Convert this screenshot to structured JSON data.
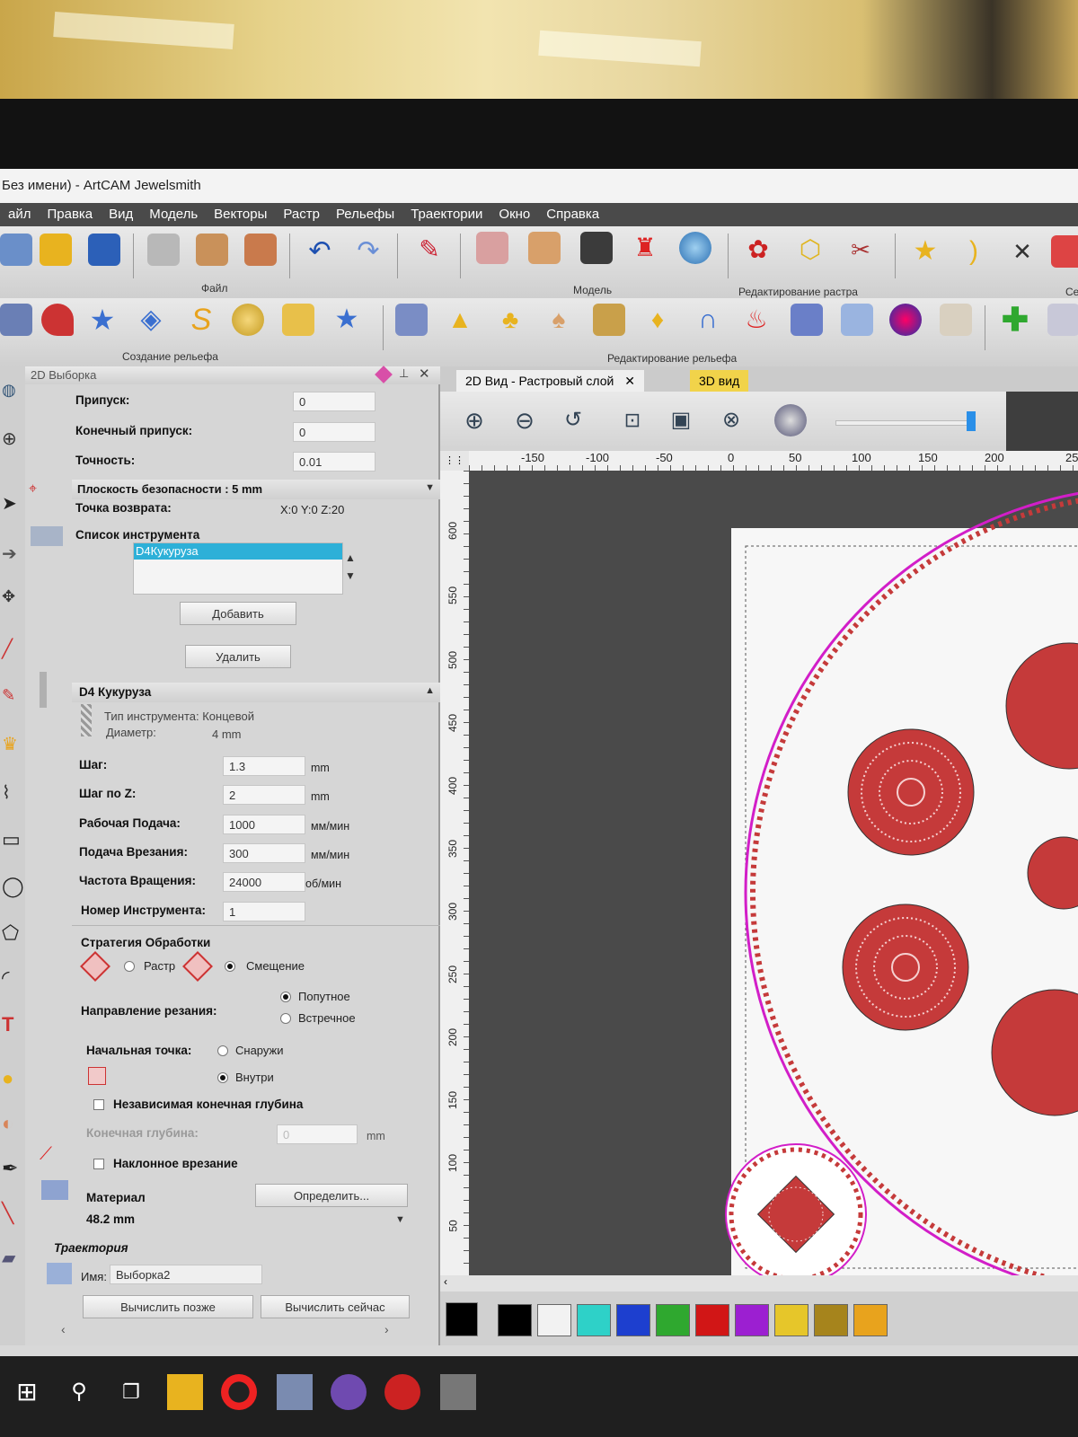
{
  "window": {
    "title": "Без имени) - ArtCAM Jewelsmith"
  },
  "menu": [
    "айл",
    "Правка",
    "Вид",
    "Модель",
    "Векторы",
    "Растр",
    "Рельефы",
    "Траектории",
    "Окно",
    "Справка"
  ],
  "toolbar_groups": {
    "file": "Файл",
    "model": "Модель",
    "raster_edit": "Редактирование растра",
    "relief_create": "Создание рельефа",
    "relief_edit": "Редактирование рельефа",
    "cut": "Се"
  },
  "panel": {
    "title": "2D Выборка",
    "allowance_label": "Припуск:",
    "allowance": "0",
    "final_allowance_label": "Конечный припуск:",
    "final_allowance": "0",
    "tolerance_label": "Точность:",
    "tolerance": "0.01",
    "safe_z": "Плоскость безопасности : 5 mm",
    "home_label": "Точка возврата:",
    "home_value": "X:0 Y:0 Z:20",
    "tool_list_label": "Список инструмента",
    "tool_selected": "D4Кукуруза",
    "add_button": "Добавить",
    "delete_button": "Удалить",
    "tool_title": "D4 Кукуруза",
    "tool_type": "Тип инструмента: Концевой",
    "diameter_label": "Диаметр:",
    "diameter": "4 mm",
    "stepover_label": "Шаг:",
    "stepover": "1.3",
    "stepover_unit": "mm",
    "stepdown_label": "Шаг по Z:",
    "stepdown": "2",
    "stepdown_unit": "mm",
    "feed_label": "Рабочая Подача:",
    "feed": "1000",
    "feed_unit": "мм/мин",
    "plunge_label": "Подача Врезания:",
    "plunge": "300",
    "plunge_unit": "мм/мин",
    "spindle_label": "Частота Вращения:",
    "spindle": "24000",
    "spindle_unit": "об/мин",
    "toolnum_label": "Номер Инструмента:",
    "toolnum": "1",
    "strategy_label": "Стратегия Обработки",
    "strategy_raster": "Растр",
    "strategy_offset": "Смещение",
    "direction_label": "Направление резания:",
    "dir_climb": "Попутное",
    "dir_conv": "Встречное",
    "start_label": "Начальная точка:",
    "start_outside": "Снаружи",
    "start_inside": "Внутри",
    "independent_depth": "Независимая конечная глубина",
    "final_depth_label": "Конечная глубина:",
    "final_depth": "0",
    "final_depth_unit": "mm",
    "ramp": "Наклонное врезание",
    "material_label": "Материал",
    "material_button": "Определить...",
    "material_value": "48.2 mm",
    "trajectory_label": "Траектория",
    "name_label": "Имя:",
    "name_value": "Выборка2",
    "calc_later": "Вычислить позже",
    "calc_now": "Вычислить сейчас"
  },
  "view": {
    "tab_2d": "2D Вид - Растровый слой",
    "tab_3d": "3D вид",
    "ruler_h": [
      "-150",
      "-100",
      "-50",
      "0",
      "50",
      "100",
      "150",
      "200",
      "25"
    ],
    "ruler_v": [
      "600",
      "550",
      "500",
      "450",
      "400",
      "350",
      "300",
      "250",
      "200",
      "150",
      "100",
      "50"
    ]
  },
  "palette": [
    "#000000",
    "#f2f2f2",
    "#2ed1c8",
    "#1d3fcf",
    "#2fa82f",
    "#d11616",
    "#9c1fd1",
    "#e6c62a",
    "#a6841c",
    "#e8a31d"
  ],
  "colors": {
    "accent": "#2db0d8",
    "tab3d": "#f1d34a",
    "toolpath": "#c53a3a",
    "boundary": "#d21ec8"
  }
}
